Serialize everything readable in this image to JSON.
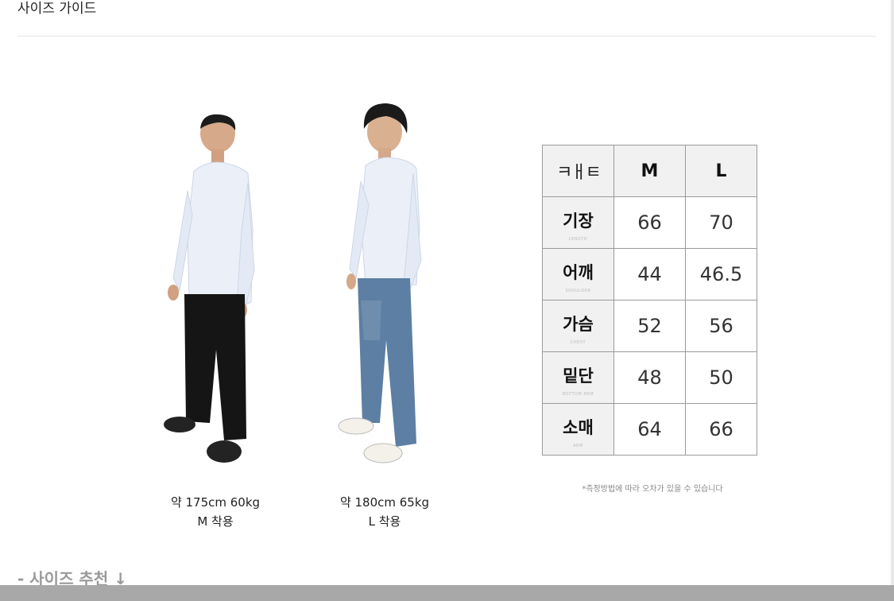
{
  "page": {
    "title": "사이즈 가이드"
  },
  "models": [
    {
      "spec": "약 175cm 60kg",
      "wearing": "M 착용"
    },
    {
      "spec": "약 180cm 65kg",
      "wearing": "L 착용"
    }
  ],
  "size_table": {
    "logo": "ㅋㅐㅌ",
    "columns": [
      "M",
      "L"
    ],
    "rows": [
      {
        "label": "기장",
        "sub": "LENGTH",
        "values": [
          "66",
          "70"
        ]
      },
      {
        "label": "어깨",
        "sub": "SHOULDER",
        "values": [
          "44",
          "46.5"
        ]
      },
      {
        "label": "가슴",
        "sub": "CHEST",
        "values": [
          "52",
          "56"
        ]
      },
      {
        "label": "밑단",
        "sub": "BOTTOM HEM",
        "values": [
          "48",
          "50"
        ]
      },
      {
        "label": "소매",
        "sub": "ARM",
        "values": [
          "64",
          "66"
        ]
      }
    ],
    "note": "*측정방법에 따라 오차가 있을 수 있습니다"
  },
  "recommendation": {
    "heading": "- 사이즈 추천 ↓"
  },
  "colors": {
    "shirt": "#e9eef8",
    "jeans": "#5c7fa3",
    "pants": "#151515",
    "table_header_bg": "#f1f1f1",
    "border": "#9a9a9a"
  }
}
